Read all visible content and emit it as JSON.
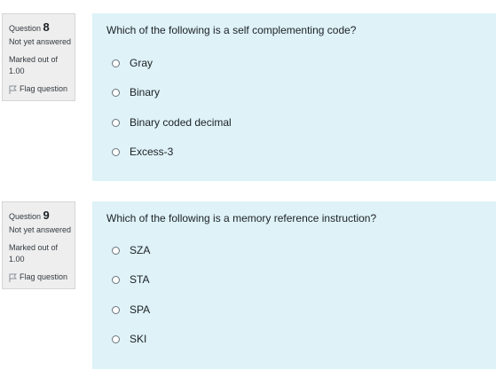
{
  "questions": [
    {
      "number_prefix": "Question",
      "number": "8",
      "state": "Not yet answered",
      "marked_out_of_label": "Marked out of",
      "marked_out_of_value": "1.00",
      "flag_label": "Flag question",
      "text": "Which of the following is a self complementing code?",
      "answers": [
        "Gray",
        "Binary",
        "Binary coded decimal",
        "Excess-3"
      ]
    },
    {
      "number_prefix": "Question",
      "number": "9",
      "state": "Not yet answered",
      "marked_out_of_label": "Marked out of",
      "marked_out_of_value": "1.00",
      "flag_label": "Flag question",
      "text": "Which of the following is a memory reference instruction?",
      "answers": [
        "SZA",
        "STA",
        "SPA",
        "SKI"
      ]
    }
  ],
  "colors": {
    "info_background": "#eeeeee",
    "content_background": "#def2f8",
    "text": "#1d2125"
  },
  "icons": {
    "flag": "flag-outline-icon",
    "radio": "radio-unselected-icon"
  }
}
